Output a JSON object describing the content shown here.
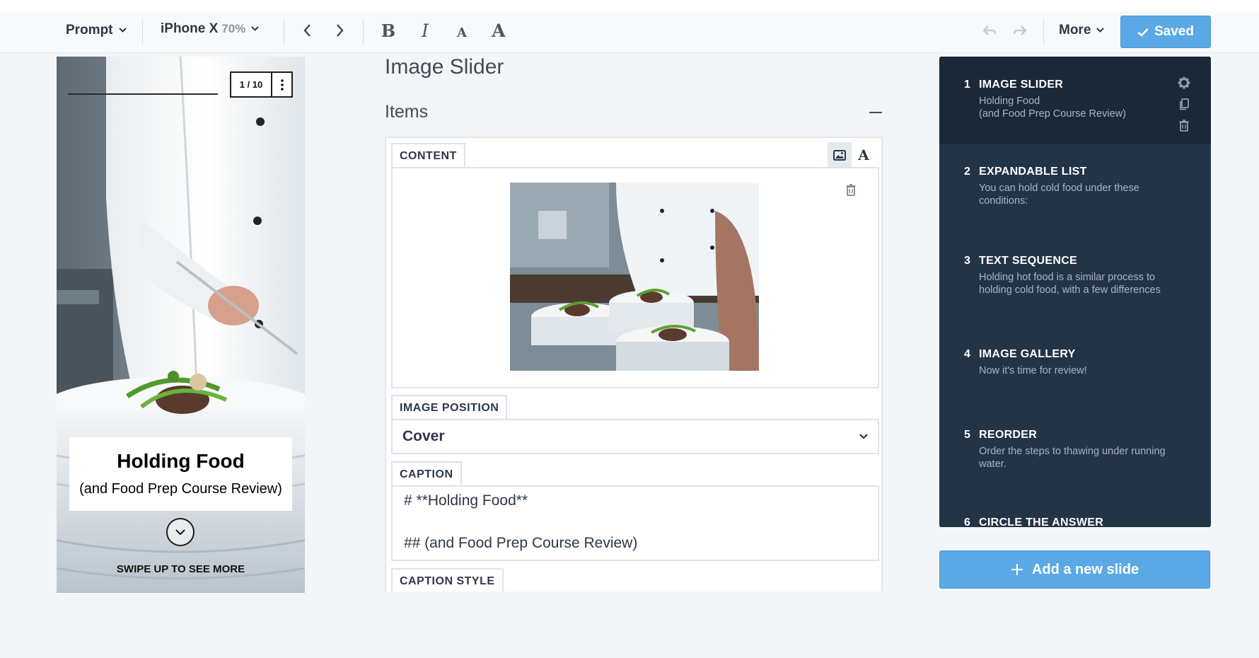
{
  "toolbar": {
    "prompt_label": "Prompt",
    "device_label": "iPhone X",
    "device_zoom": "70%",
    "more_label": "More",
    "saved_label": "Saved"
  },
  "preview": {
    "counter": "1 / 10",
    "caption_title": "Holding Food",
    "caption_subtitle": "(and Food Prep Course Review)",
    "swipe_text": "SWIPE UP TO SEE MORE"
  },
  "editor": {
    "title": "Image Slider",
    "items_label": "Items",
    "content_tab": "CONTENT",
    "image_position_tab": "IMAGE POSITION",
    "image_position_value": "Cover",
    "caption_tab": "CAPTION",
    "caption_line_1": "# **Holding Food**",
    "caption_line_2": "## (and Food Prep Course Review)",
    "caption_style_tab": "CAPTION STYLE"
  },
  "slides": [
    {
      "num": "1",
      "title": "IMAGE SLIDER",
      "desc": "Holding Food\n(and Food Prep Course Review)"
    },
    {
      "num": "2",
      "title": "EXPANDABLE LIST",
      "desc": "You can hold cold food under these conditions:"
    },
    {
      "num": "3",
      "title": "TEXT SEQUENCE",
      "desc": "Holding hot food is a similar process to holding cold food, with a few differences"
    },
    {
      "num": "4",
      "title": "IMAGE GALLERY",
      "desc": "Now it's time for review!"
    },
    {
      "num": "5",
      "title": "REORDER",
      "desc": "Order the steps to thawing under running water."
    },
    {
      "num": "6",
      "title": "CIRCLE THE ANSWER",
      "desc": ""
    }
  ],
  "add_slide_label": "Add a new slide",
  "colors": {
    "accent": "#5aa9e6",
    "panel_bg": "#243447",
    "panel_active": "#1b2837"
  },
  "icons": [
    "chevron-down-icon",
    "arrow-left-icon",
    "arrow-right-icon",
    "bold-icon",
    "italic-icon",
    "font-small-icon",
    "font-large-icon",
    "undo-icon",
    "redo-icon",
    "check-icon",
    "more-vert-icon",
    "chevron-circle-down-icon",
    "image-icon",
    "text-icon",
    "trash-icon",
    "gear-icon",
    "copy-icon",
    "plus-icon",
    "minus-icon"
  ]
}
